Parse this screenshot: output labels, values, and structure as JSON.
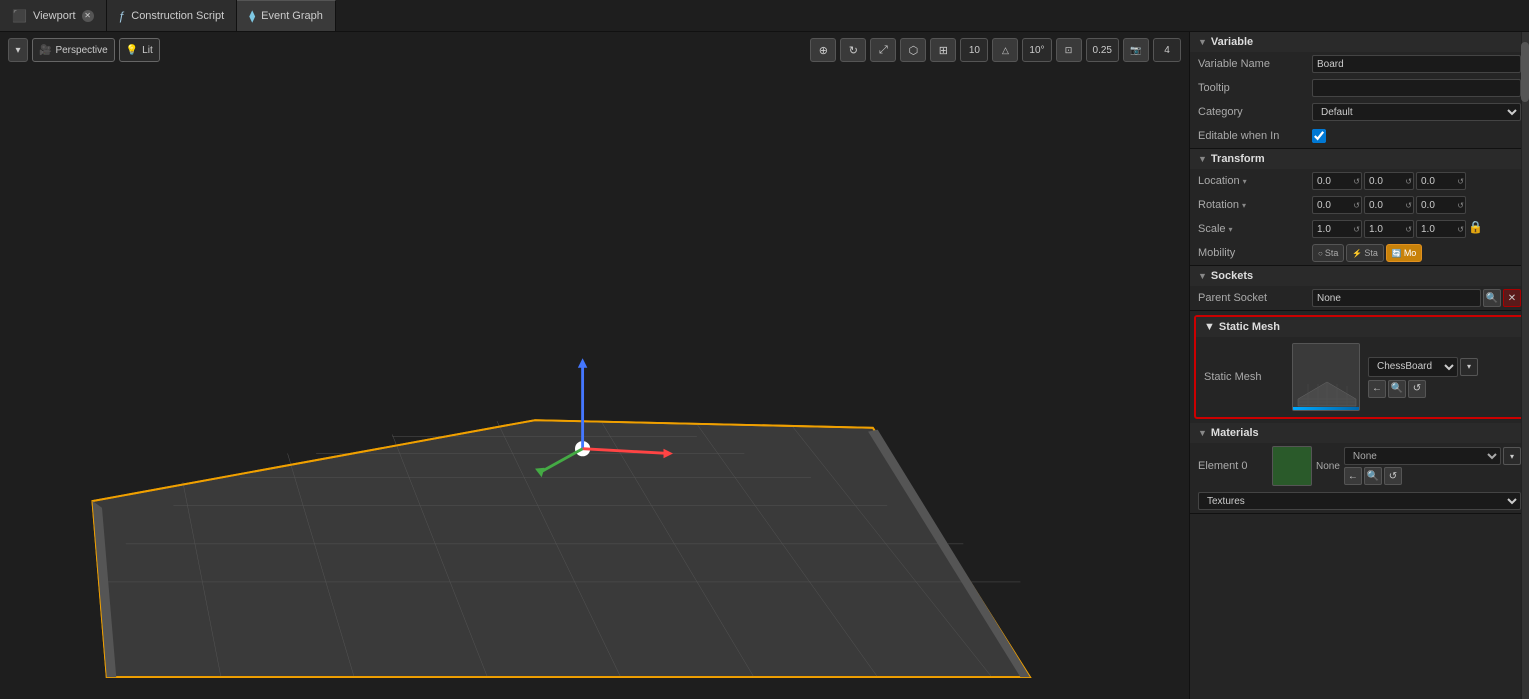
{
  "tabs": [
    {
      "id": "viewport",
      "label": "Viewport",
      "icon": "viewport-icon",
      "closable": true,
      "active": false
    },
    {
      "id": "construction-script",
      "label": "Construction Script",
      "icon": "script-icon",
      "closable": false,
      "active": false
    },
    {
      "id": "event-graph",
      "label": "Event Graph",
      "icon": "graph-icon",
      "closable": false,
      "active": true
    }
  ],
  "toolbar": {
    "perspective_label": "Perspective",
    "lit_label": "Lit",
    "num1": "10",
    "num2": "10°",
    "num3": "0.25",
    "num4": "4"
  },
  "panel": {
    "variable_section": "Variable",
    "variable_name_label": "Variable Name",
    "variable_name_value": "Board",
    "tooltip_label": "Tooltip",
    "tooltip_value": "",
    "category_label": "Category",
    "category_value": "Default",
    "editable_label": "Editable when In",
    "transform_section": "Transform",
    "location_label": "Location",
    "location_x": "0.0",
    "location_y": "0.0",
    "location_z": "0.0",
    "rotation_label": "Rotation",
    "rotation_x": "0.0",
    "rotation_y": "0.0",
    "rotation_z": "0.0",
    "scale_label": "Scale",
    "scale_x": "1.0",
    "scale_y": "1.0",
    "scale_z": "1.0",
    "mobility_label": "Mobility",
    "mobility_static": "Sta",
    "mobility_stationary": "Sta",
    "mobility_movable": "Mo",
    "sockets_section": "Sockets",
    "parent_socket_label": "Parent Socket",
    "parent_socket_value": "None",
    "static_mesh_section": "Static Mesh",
    "static_mesh_label": "Static Mesh",
    "static_mesh_name": "ChessBoard",
    "materials_section": "Materials",
    "element0_label": "Element 0",
    "element0_name": "None",
    "textures_label": "Textures"
  }
}
